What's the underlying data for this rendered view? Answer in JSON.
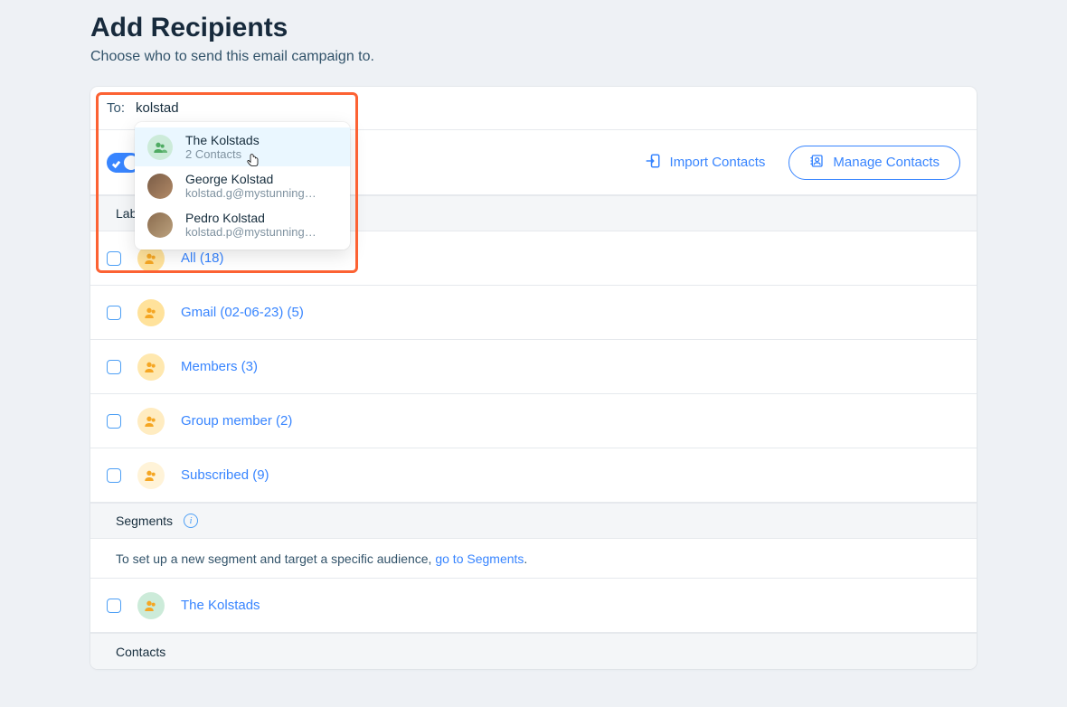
{
  "header": {
    "title": "Add Recipients",
    "subtitle": "Choose who to send this email campaign to."
  },
  "to": {
    "label": "To:",
    "value": "kolstad"
  },
  "dropdown": {
    "items": [
      {
        "title": "The Kolstads",
        "sub": "2 Contacts",
        "kind": "group",
        "selected": true
      },
      {
        "title": "George Kolstad",
        "sub": "kolstad.g@mystunning…",
        "kind": "person"
      },
      {
        "title": "Pedro Kolstad",
        "sub": "kolstad.p@mystunning…",
        "kind": "person"
      }
    ]
  },
  "actions": {
    "suffix": ")",
    "import": "Import Contacts",
    "manage": "Manage Contacts"
  },
  "sections": {
    "labels": "Lab",
    "segments": "Segments",
    "contacts": "Contacts"
  },
  "label_items": [
    {
      "name": "All (18)"
    },
    {
      "name": "Gmail (02-06-23) (5)"
    },
    {
      "name": "Members (3)"
    },
    {
      "name": "Group member (2)"
    },
    {
      "name": "Subscribed (9)"
    }
  ],
  "segments_blurb": {
    "prefix": "To set up a new segment and target a specific audience, ",
    "link": "go to Segments",
    "suffix": "."
  },
  "segment_items": [
    {
      "name": "The Kolstads"
    }
  ]
}
